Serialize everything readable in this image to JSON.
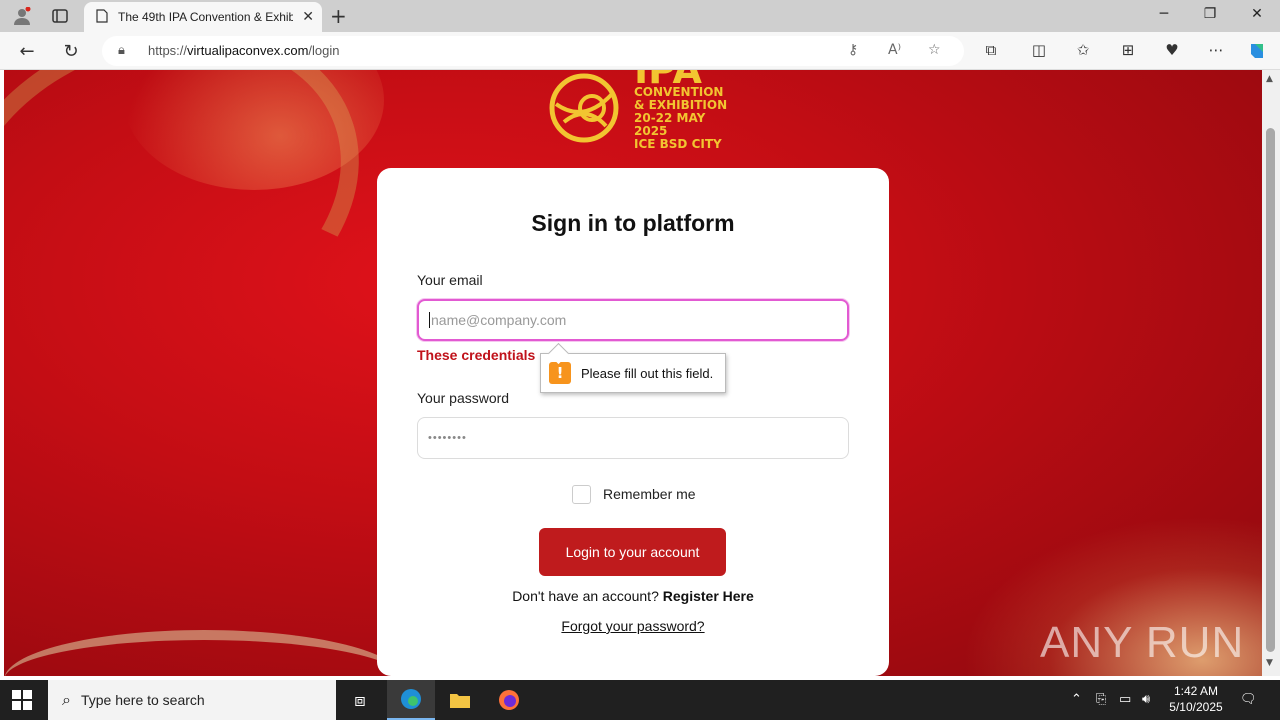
{
  "browser": {
    "tab_title": "The 49th IPA Convention & Exhibition",
    "url_prefix": "https://",
    "url_domain": "virtualipaconvex.com",
    "url_path": "/login"
  },
  "logo": {
    "mark": "IPA",
    "line1": "CONVENTION",
    "line2": "& EXHIBITION",
    "line3": "20-22 MAY 2025",
    "line4": "ICE BSD CITY"
  },
  "login": {
    "heading": "Sign in to platform",
    "email_label": "Your email",
    "email_placeholder": "name@company.com",
    "error_text": "These credentials",
    "tooltip_text": "Please fill out this field.",
    "password_label": "Your password",
    "password_value": "••••••••",
    "remember_label": "Remember me",
    "submit_label": "Login to your account",
    "no_account_text": "Don't have an account?",
    "register_link": "Register Here",
    "forgot_link": "Forgot your password?"
  },
  "watermark": "ANY RUN",
  "taskbar": {
    "search_placeholder": "Type here to search",
    "time": "1:42 AM",
    "date": "5/10/2025"
  },
  "colors": {
    "brand_red": "#bf1b1d",
    "logo_gold": "#f2c531",
    "focus_ring": "#e25ad2",
    "warning": "#f7941d"
  }
}
